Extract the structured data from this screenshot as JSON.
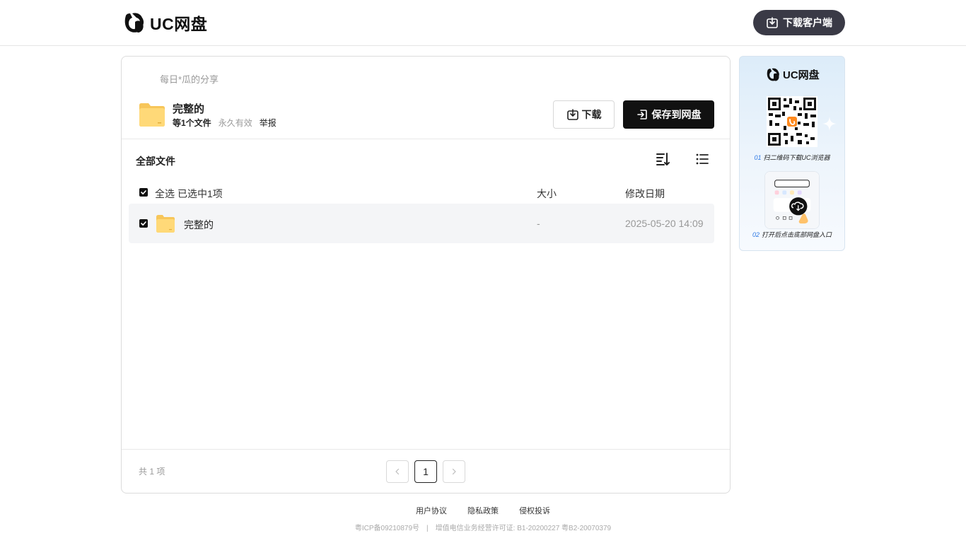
{
  "header": {
    "logo_text": "UC网盘",
    "download_client_label": "下载客户端"
  },
  "share": {
    "sharer": "每日*瓜的分享",
    "title": "完整的",
    "file_count": "等1个文件",
    "validity": "永久有效",
    "report": "举报",
    "download_label": "下载",
    "save_label": "保存到网盘"
  },
  "files": {
    "section_title": "全部文件",
    "select_all": "全选",
    "selected_count": "已选中1项",
    "columns": {
      "size": "大小",
      "date": "修改日期"
    },
    "rows": [
      {
        "name": "完整的",
        "size": "-",
        "date": "2025-05-20 14:09",
        "checked": true
      }
    ],
    "total": "共 1 项"
  },
  "pagination": {
    "prev": "<",
    "current": "1",
    "next": ">"
  },
  "promo": {
    "logo_text": "UC网盘",
    "step1_num": "01",
    "step1_text": "扫二维码下载UC浏览器",
    "step2_num": "02",
    "step2_text": "打开后点击底部网盘入口"
  },
  "footer": {
    "links": [
      "用户协议",
      "隐私政策",
      "侵权投诉"
    ],
    "icp": "粤ICP备09210879号",
    "separator": "|",
    "license": "增值电信业务经营许可证: B1-20200227 粤B2-20070379"
  },
  "colors": {
    "primary_dark": "#111111",
    "client_button": "#3a3a46",
    "folder_yellow": "#ffd36b",
    "row_highlight": "#f4f5f7",
    "promo_accent": "#2f7ae5"
  },
  "icons": [
    "uc-logo-icon",
    "download-icon",
    "save-icon",
    "folder-icon",
    "sort-icon",
    "list-view-icon",
    "checkbox-icon",
    "qr-code-icon"
  ]
}
